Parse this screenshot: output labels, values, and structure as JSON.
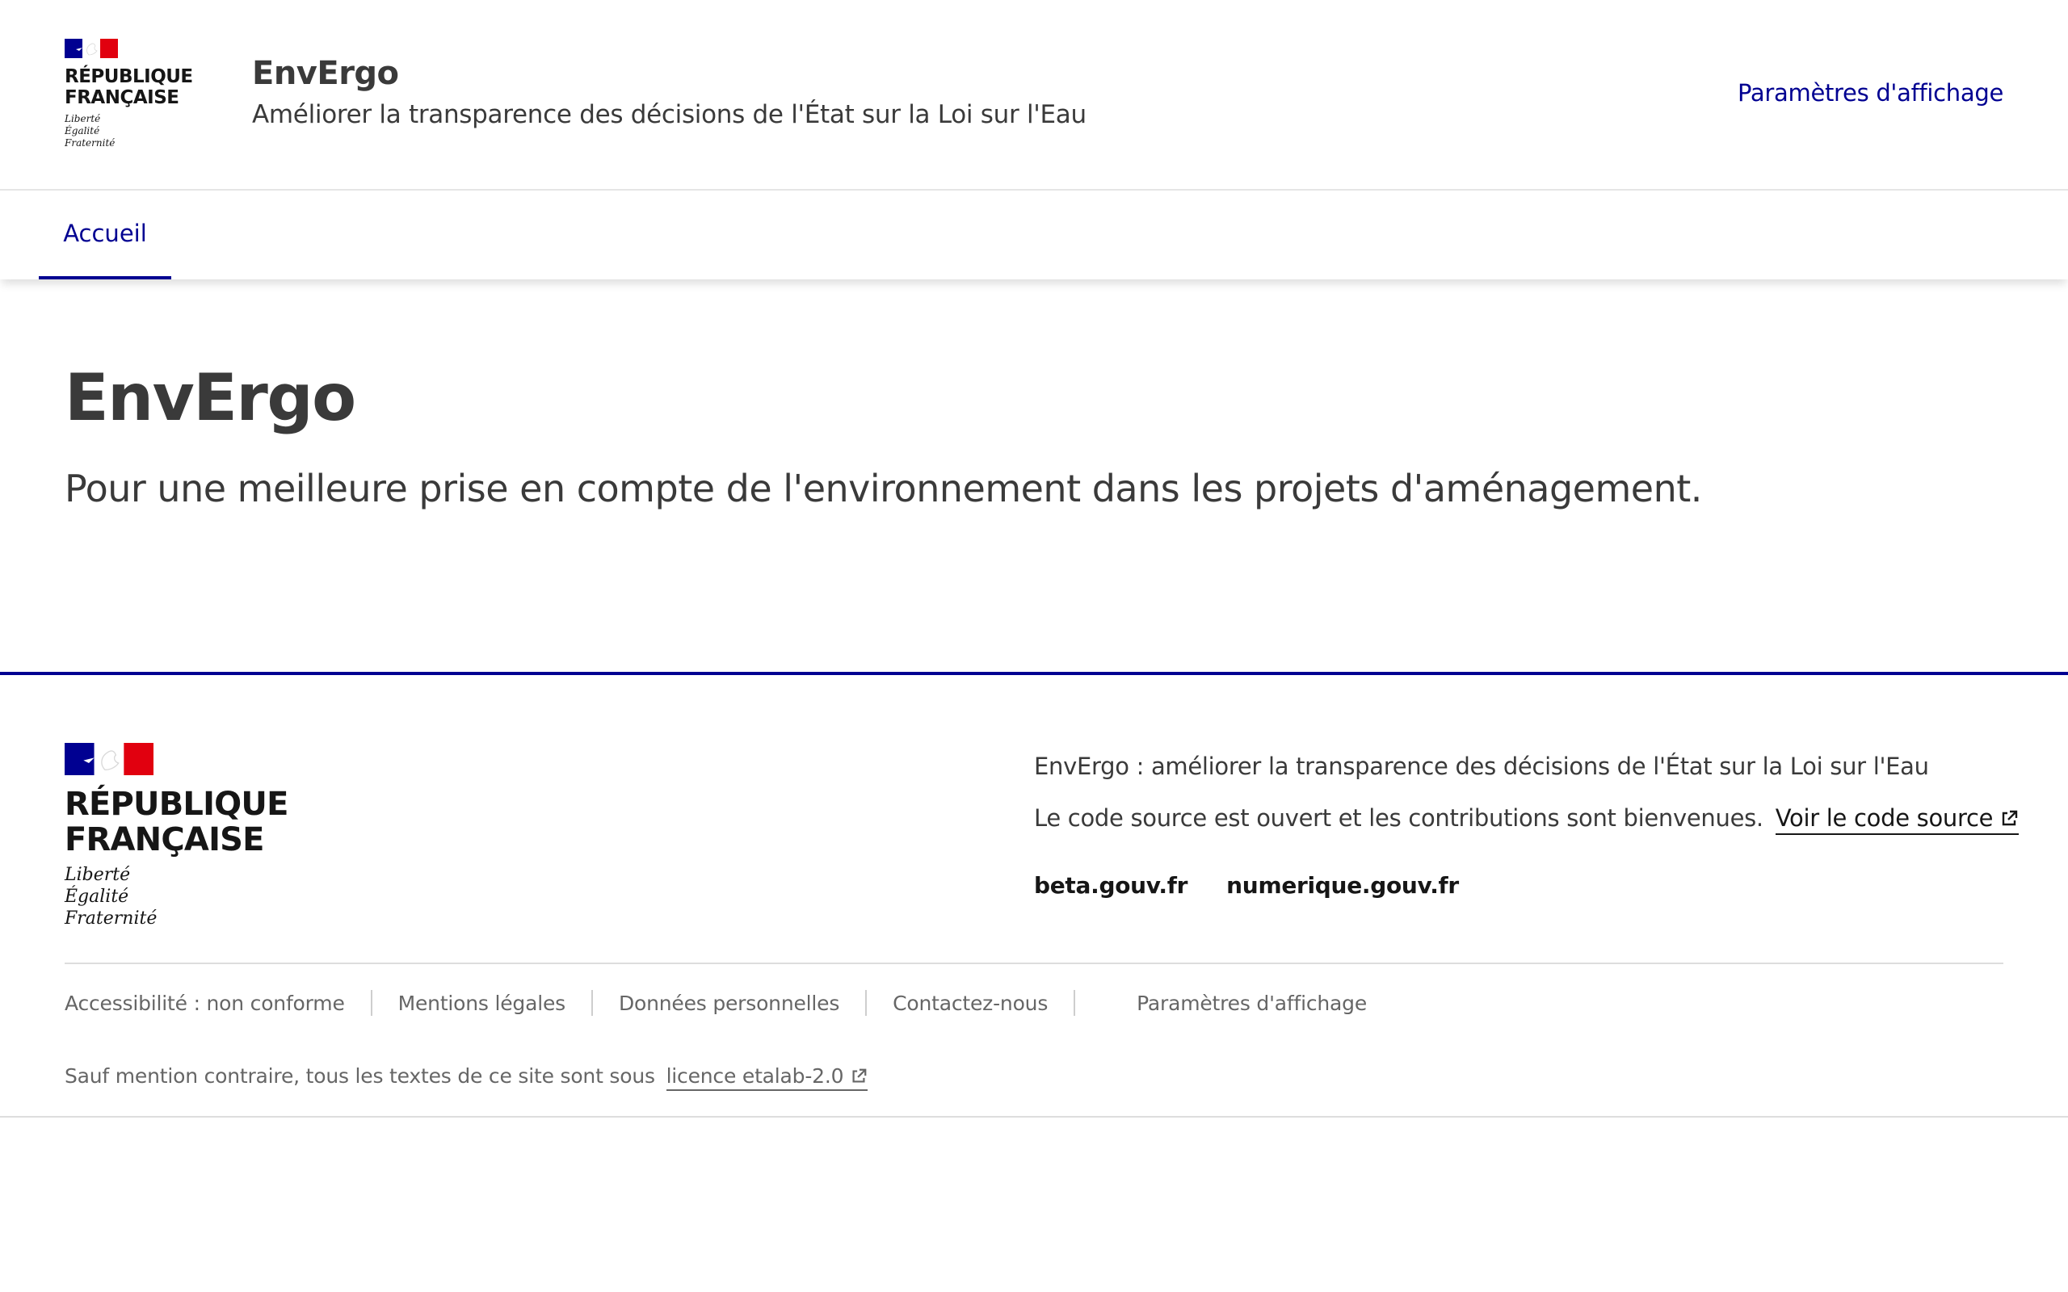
{
  "header": {
    "logo_text": [
      "RÉPUBLIQUE",
      "FRANÇAISE"
    ],
    "devise": [
      "Liberté",
      "Égalité",
      "Fraternité"
    ],
    "title": "EnvErgo",
    "tagline": "Améliorer la transparence des décisions de l'État sur la Loi sur l'Eau",
    "display_settings": "Paramètres d'affichage"
  },
  "nav": {
    "items": [
      {
        "label": "Accueil",
        "active": true
      }
    ]
  },
  "main": {
    "title": "EnvErgo",
    "lead": "Pour une meilleure prise en compte de l'environnement dans les projets d'aménagement."
  },
  "footer": {
    "logo_text": [
      "RÉPUBLIQUE",
      "FRANÇAISE"
    ],
    "devise": [
      "Liberté",
      "Égalité",
      "Fraternité"
    ],
    "description": "EnvErgo : améliorer la transparence des décisions de l'État sur la Loi sur l'Eau",
    "source_text": "Le code source est ouvert et les contributions sont bienvenues.",
    "source_link": "Voir le code source",
    "links": [
      "beta.gouv.fr",
      "numerique.gouv.fr"
    ],
    "bottom_links": [
      "Accessibilité : non conforme",
      "Mentions légales",
      "Données personnelles",
      "Contactez-nous",
      "Paramètres d'affichage"
    ],
    "licence_text": "Sauf mention contraire, tous les textes de ce site sont sous",
    "licence_link": "licence etalab-2.0"
  },
  "colors": {
    "brand_blue": "#000091",
    "brand_red": "#e1000f",
    "text": "#3a3a3a",
    "muted": "#666666"
  },
  "icons": [
    "marianne-flag-icon",
    "external-link-icon"
  ]
}
